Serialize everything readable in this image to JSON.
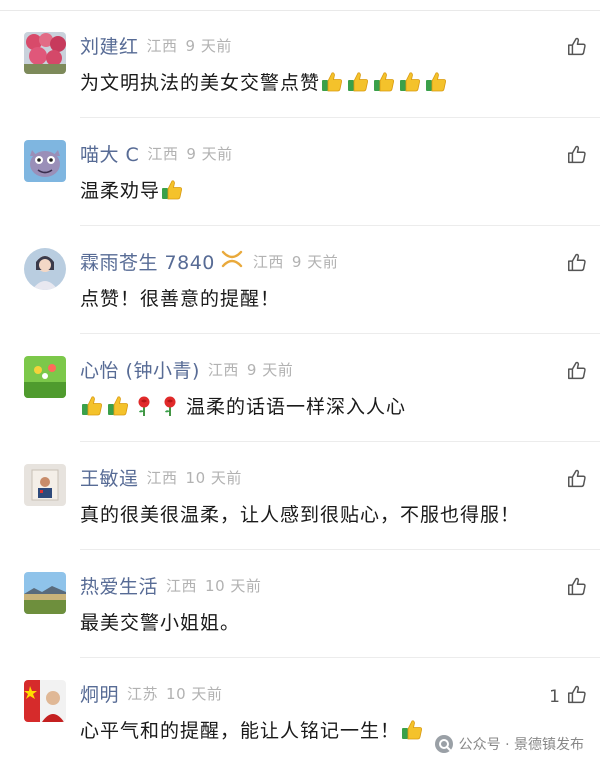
{
  "comments": [
    {
      "name": "刘建红",
      "region": "江西",
      "time": "9 天前",
      "text": "为文明执法的美女交警点赞",
      "thumbs": 5,
      "flowers": 0,
      "trail": "",
      "likes": ""
    },
    {
      "name": "喵大 C",
      "region": "江西",
      "time": "9 天前",
      "text": "温柔劝导",
      "thumbs": 1,
      "flowers": 0,
      "trail": "",
      "likes": ""
    },
    {
      "name": "霖雨苍生 7840",
      "region": "江西",
      "time": "9 天前",
      "text": "点赞！很善意的提醒！",
      "thumbs": 0,
      "flowers": 0,
      "trail": "",
      "likes": "",
      "badge": "ribbon-icon"
    },
    {
      "name": "心怡 (钟小青)",
      "region": "江西",
      "time": "9 天前",
      "text": "",
      "thumbs": 2,
      "flowers": 2,
      "trail": "温柔的话语一样深入人心",
      "likes": ""
    },
    {
      "name": "王敏逞",
      "region": "江西",
      "time": "10 天前",
      "text": "真的很美很温柔，让人感到很贴心，不服也得服！",
      "thumbs": 0,
      "flowers": 0,
      "trail": "",
      "likes": ""
    },
    {
      "name": "热爱生活",
      "region": "江西",
      "time": "10 天前",
      "text": "最美交警小姐姐。",
      "thumbs": 0,
      "flowers": 0,
      "trail": "",
      "likes": ""
    },
    {
      "name": "炯明",
      "region": "江苏",
      "time": "10 天前",
      "text": "心平气和的提醒，能让人铭记一生！",
      "thumbs": 1,
      "flowers": 0,
      "trail": "",
      "likes": "1"
    }
  ],
  "watermark": {
    "text": "公众号 · 景德镇发布"
  },
  "colors": {
    "name": "#576b95",
    "meta": "#b2b2b2",
    "text": "#1a1a1a",
    "divider": "#ececec"
  }
}
